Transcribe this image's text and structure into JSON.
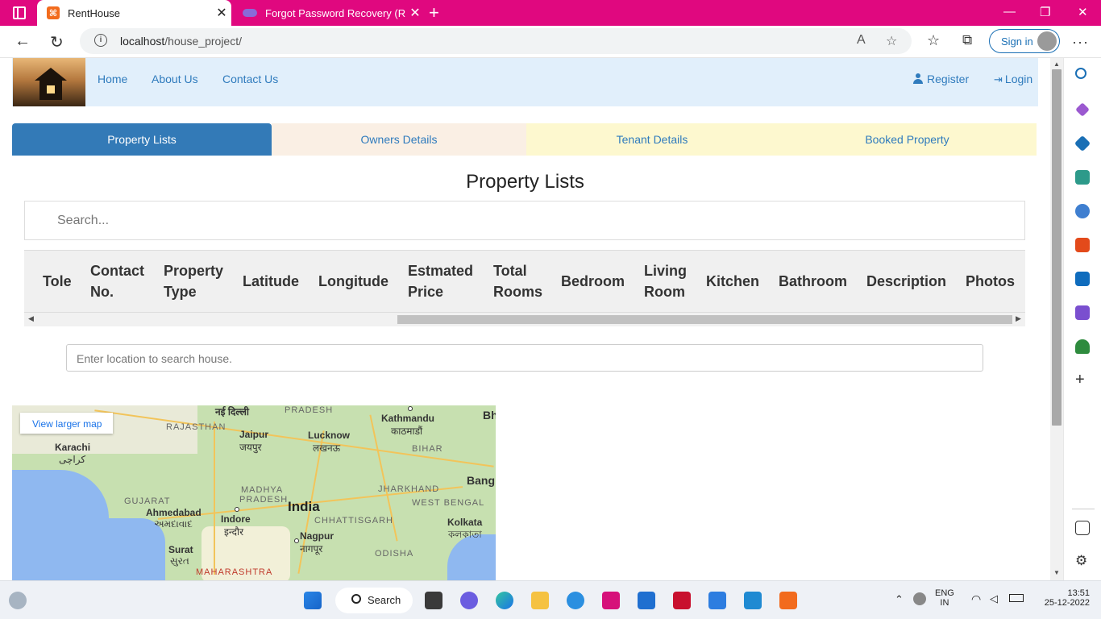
{
  "browser": {
    "tabs": [
      {
        "title": "RentHouse",
        "active": true
      },
      {
        "title": "Forgot Password Recovery (Reset",
        "active": false
      }
    ],
    "url_host": "localhost",
    "url_path": "/house_project/",
    "signin_label": "Sign in"
  },
  "site": {
    "nav": {
      "home": "Home",
      "about": "About Us",
      "contact": "Contact Us",
      "register": "Register",
      "login": "Login"
    },
    "tabs": [
      {
        "label": "Property Lists",
        "bg": "#337ab7",
        "color": "#ffffff"
      },
      {
        "label": "Owners Details",
        "bg": "#faefe4",
        "color": "#2f7bbd"
      },
      {
        "label": "Tenant Details",
        "bg": "#fdf8cf",
        "color": "#2f7bbd"
      },
      {
        "label": "Booked Property",
        "bg": "#fdf8cf",
        "color": "#2f7bbd"
      }
    ],
    "page_title": "Property Lists",
    "search_placeholder": "Search...",
    "table_headers": [
      "Tole",
      "Contact No.",
      "Property Type",
      "Latitude",
      "Longitude",
      "Estmated Price",
      "Total Rooms",
      "Bedroom",
      "Living Room",
      "Kitchen",
      "Bathroom",
      "Description",
      "Photos"
    ],
    "location_placeholder": "Enter location to search house.",
    "map": {
      "view_larger": "View larger map",
      "labels": {
        "delhi": "नई दिल्ली",
        "pradesh": "PRADESH",
        "kathmandu": "Kathmandu",
        "kathmandu_local": "काठमाडौं",
        "bh": "Bh",
        "rajasthan": "RAJASTHAN",
        "karachi": "Karachi",
        "karachi_local": "کراچی",
        "jaipur": "Jaipur",
        "jaipur_local": "जयपुर",
        "lucknow": "Lucknow",
        "lucknow_local": "लखनऊ",
        "bihar": "BIHAR",
        "bang": "Bang",
        "madhya": "MADHYA",
        "madhya2": "PRADESH",
        "jharkhand": "JHARKHAND",
        "gujarat": "GUJARAT",
        "india": "India",
        "west_bengal": "WEST BENGAL",
        "ahmedabad": "Ahmedabad",
        "ahmedabad_local": "અમદાવાદ",
        "indore": "Indore",
        "indore_local": "इन्दौर",
        "chhattisgarh": "CHHATTISGARH",
        "kolkata": "Kolkata",
        "kolkata_local": "কলকাতা",
        "nagpur": "Nagpur",
        "nagpur_local": "नागपूर",
        "surat": "Surat",
        "surat_local": "સુરત",
        "odisha": "ODISHA",
        "maharashtra": "MAHARASHTRA"
      }
    }
  },
  "taskbar": {
    "search_label": "Search",
    "lang": "ENG",
    "region": "IN",
    "time": "13:51",
    "date": "25-12-2022"
  }
}
